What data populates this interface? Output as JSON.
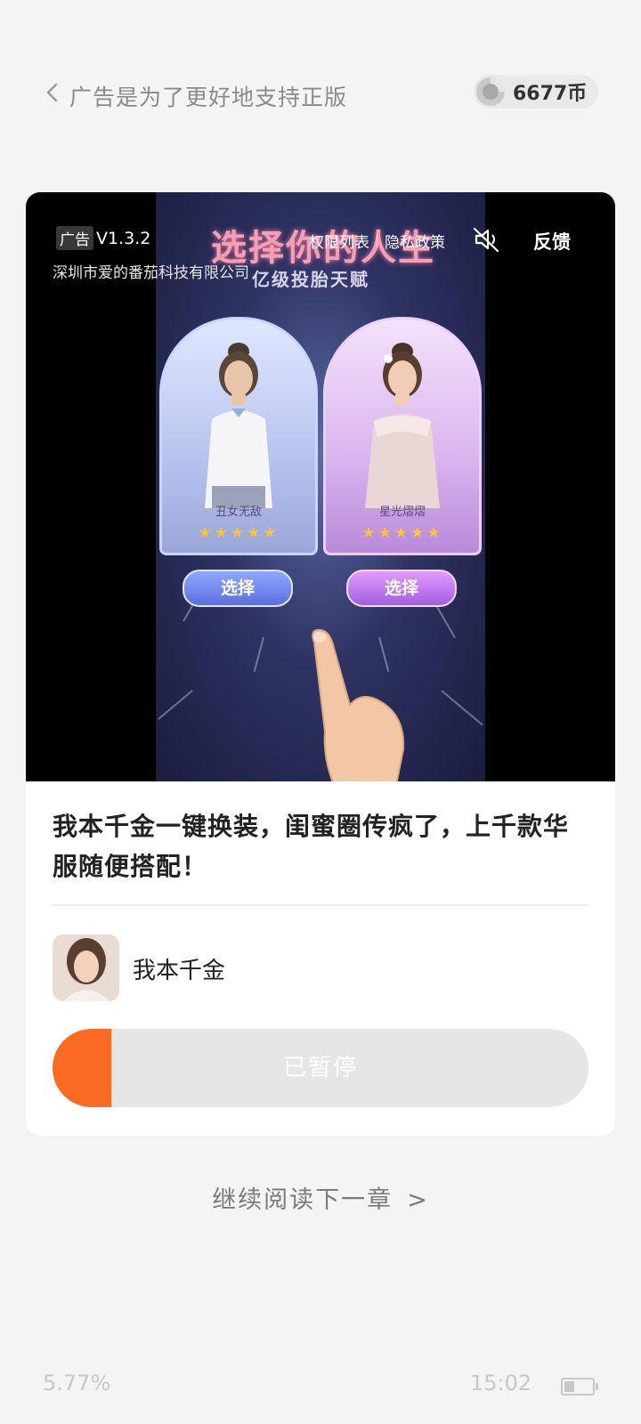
{
  "header": {
    "title": "广告是为了更好地支持正版",
    "coins": "6677币",
    "icons": {
      "back": "chevron-left-icon",
      "coin": "coin-icon"
    }
  },
  "ad": {
    "label": "广告",
    "version": "V1.3.2",
    "company": "深圳市爱的番茄科技有限公司",
    "permissions_link": "权限列表",
    "privacy_link": "隐私政策",
    "feedback": "反馈",
    "video": {
      "title": "选择你的人生",
      "subtitle": "亿级投胎天赋",
      "left_character": "丑女无敌",
      "right_character": "星光熠熠",
      "stars": "★★★★★",
      "select_label": "选择"
    },
    "headline": "我本千金一键换装，闺蜜圈传疯了，上千款华服随便搭配！",
    "app_name": "我本千金",
    "download_status": "已暂停",
    "download_progress": 0.11
  },
  "continue_reading": "继续阅读下一章",
  "continue_arrow": ">",
  "status": {
    "progress": "5.77%",
    "time": "15:02",
    "battery_level": 0.35
  },
  "colors": {
    "accent": "#fb6a22",
    "background": "#f4f4f4"
  }
}
